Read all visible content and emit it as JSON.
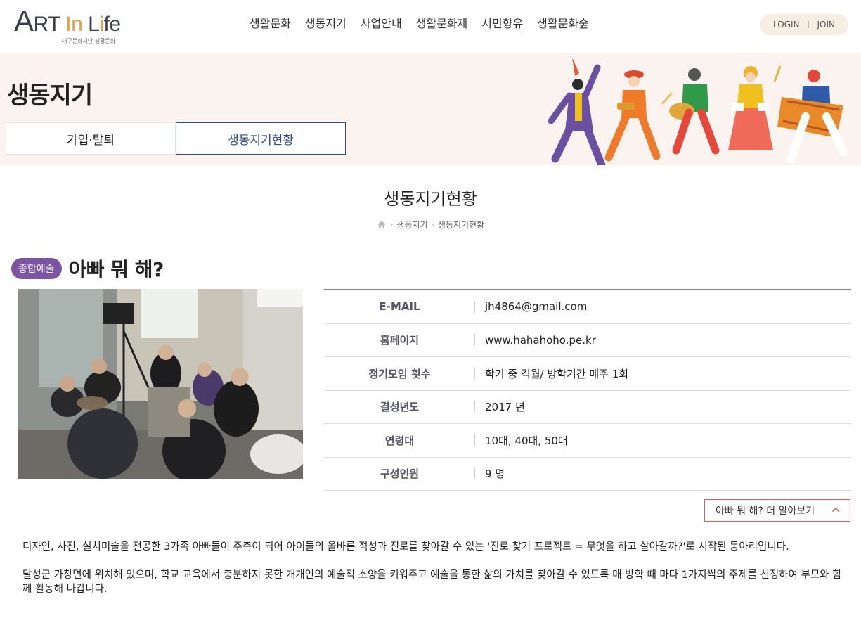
{
  "header": {
    "logo_text": "ART In Life",
    "logo_sub": "대구문화재단 생활문화",
    "nav": [
      "생활문화",
      "생동지기",
      "사업안내",
      "생활문화제",
      "시민향유",
      "생활문화숲"
    ],
    "login": "LOGIN",
    "join": "JOIN"
  },
  "banner": {
    "title": "생동지기",
    "tabs": [
      {
        "label": "가입·탈퇴"
      },
      {
        "label": "생동지기현황"
      }
    ]
  },
  "page": {
    "title": "생동지기현황",
    "breadcrumb": [
      "생동지기",
      "생동지기현황"
    ]
  },
  "club": {
    "category": "종합예술",
    "name": "아빠 뭐 해?",
    "info": [
      {
        "label": "E-MAIL",
        "value": "jh4864@gmail.com"
      },
      {
        "label": "홈페이지",
        "value": "www.hahahoho.pe.kr"
      },
      {
        "label": "정기모임 횟수",
        "value": "학기 중 격월/ 방학기간 매주 1회"
      },
      {
        "label": "결성년도",
        "value": "2017 년"
      },
      {
        "label": "연령대",
        "value": "10대, 40대, 50대"
      },
      {
        "label": "구성인원",
        "value": "9 명"
      }
    ],
    "more_label": "아빠 뭐 해? 더 알아보기",
    "description": [
      "디자인, 사진, 설치미술을 전공한 3가족 아빠들이 주축이 되어 아이들의 올바른 적성과 진로를 찾아갈 수 있는 '진로 찾기 프로젝트 = 무엇을 하고 살아갈까?'로 시작된 동아리입니다.",
      "달성군 가창면에 위치해 있으며, 학교 교육에서 충분하지 못한 개개인의 예술적 소양을 키워주고 예술을 통한 삶의 가치를 찾아갈 수 있도록 매 방학 때 마다 1가지씩의 주제를 선정하여 부모와 함께 활동해 나갑니다."
    ]
  },
  "colors": {
    "badge": "#7b55a3",
    "active_tab": "#2d4a8a",
    "banner_bg": "#faf3ef",
    "more_border": "#e05a5a"
  }
}
